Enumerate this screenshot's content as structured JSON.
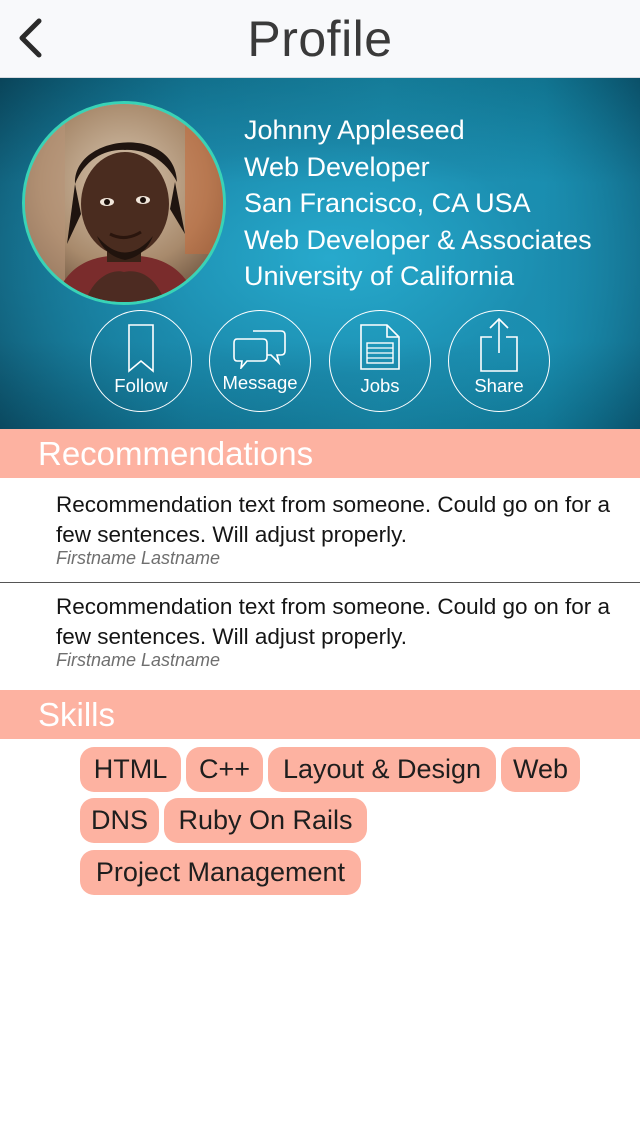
{
  "nav": {
    "title": "Profile"
  },
  "profile": {
    "name": "Johnny Appleseed",
    "title": "Web Developer",
    "location": "San Francisco, CA  USA",
    "company": "Web Developer & Associates",
    "school": "University of California"
  },
  "actions": [
    {
      "label": "Follow",
      "icon": "bookmark-icon"
    },
    {
      "label": "Message",
      "icon": "chat-bubbles-icon"
    },
    {
      "label": "Jobs",
      "icon": "document-icon"
    },
    {
      "label": "Share",
      "icon": "share-icon"
    }
  ],
  "recommendations": {
    "header": "Recommendations",
    "items": [
      {
        "text": "Recommendation text from someone.  Could go on for a few sentences.  Will adjust properly.",
        "author": "Firstname Lastname"
      },
      {
        "text": "Recommendation text from someone.  Could go on for a few sentences.  Will adjust properly.",
        "author": "Firstname Lastname"
      }
    ]
  },
  "skills": {
    "header": "Skills",
    "items": [
      "HTML",
      "C++",
      "Layout & Design",
      "Web",
      "DNS",
      "Ruby On Rails",
      "Project Management"
    ]
  },
  "colors": {
    "accent": "#fdb2a1",
    "header_teal": "#1aa6c6",
    "avatar_ring": "#39d3b6"
  }
}
